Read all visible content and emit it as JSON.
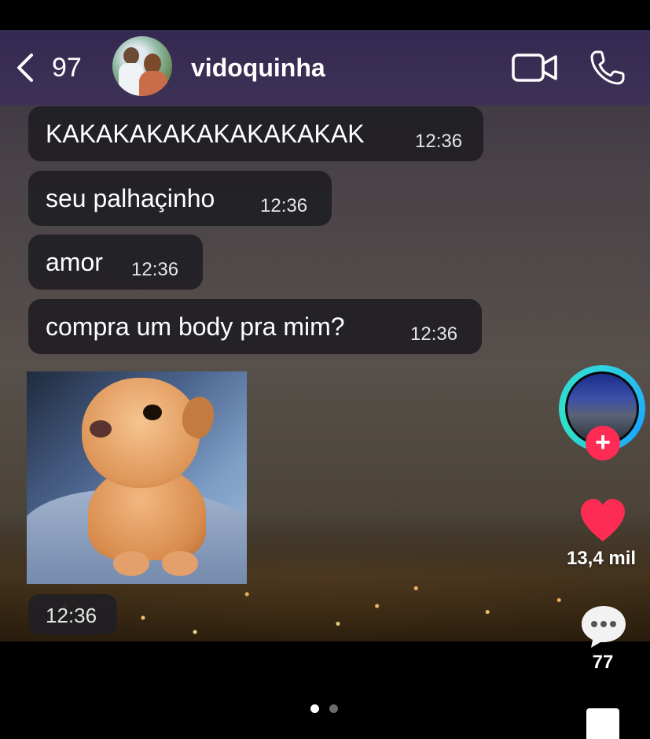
{
  "header": {
    "unread_count": "97",
    "contact_name": "vidoquinha"
  },
  "messages": [
    {
      "text": "KAKAKAKAKAKAKAKAKAK",
      "time": "12:36"
    },
    {
      "text": "seu palhaçinho",
      "time": "12:36"
    },
    {
      "text": "amor",
      "time": "12:36"
    },
    {
      "text": "compra um body pra mim?",
      "time": "12:36"
    }
  ],
  "image_message": {
    "time": "12:36"
  },
  "sidebar": {
    "follow_symbol": "+",
    "likes": "13,4 mil",
    "comments": "77"
  },
  "pager": {
    "pages": 2,
    "current": 1
  },
  "icons": {
    "back": "chevron-left-icon",
    "video": "video-camera-icon",
    "phone": "phone-icon",
    "like": "heart-icon",
    "comment": "comment-bubble-icon"
  },
  "colors": {
    "header_bg": "#34285a",
    "bubble_bg": "#201f24",
    "like_red": "#fe2c55",
    "ring": "#2fd3e0"
  }
}
